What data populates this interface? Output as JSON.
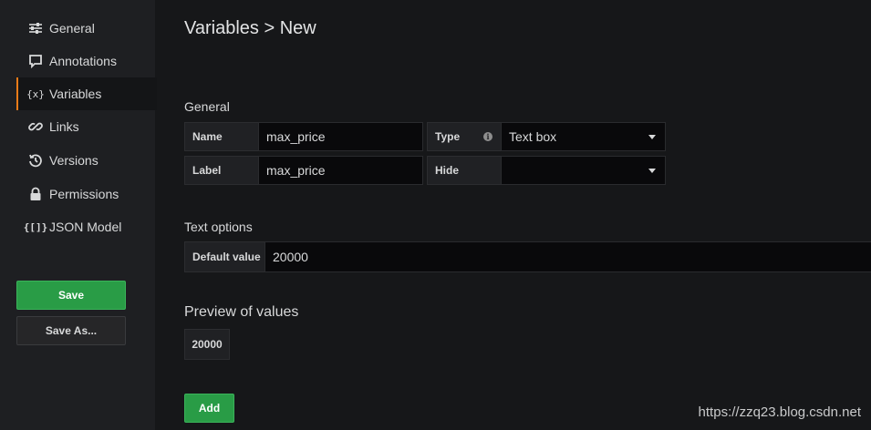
{
  "sidebar": {
    "items": [
      {
        "label": "General",
        "icon": "sliders-icon",
        "active": false
      },
      {
        "label": "Annotations",
        "icon": "comment-icon",
        "active": false
      },
      {
        "label": "Variables",
        "icon": "variable-braces-icon",
        "active": true
      },
      {
        "label": "Links",
        "icon": "link-icon",
        "active": false
      },
      {
        "label": "Versions",
        "icon": "history-icon",
        "active": false
      },
      {
        "label": "Permissions",
        "icon": "lock-icon",
        "active": false
      },
      {
        "label": "JSON Model",
        "icon": "json-brackets-icon",
        "active": false
      }
    ],
    "save_label": "Save",
    "save_as_label": "Save As..."
  },
  "header": {
    "title": "Variables > New"
  },
  "general": {
    "section_title": "General",
    "name_label": "Name",
    "name_value": "max_price",
    "type_label": "Type",
    "type_value": "Text box",
    "label_label": "Label",
    "label_value": "max_price",
    "hide_label": "Hide",
    "hide_value": ""
  },
  "text_options": {
    "section_title": "Text options",
    "default_label": "Default value",
    "default_value": "20000"
  },
  "preview": {
    "section_title": "Preview of values",
    "values": [
      "20000"
    ]
  },
  "add_label": "Add",
  "watermark": "https://zzq23.blog.csdn.net",
  "colors": {
    "accent": "#eb7b18",
    "primary_button": "#299c46",
    "background": "#161719",
    "sidebar": "#1e1f22"
  }
}
